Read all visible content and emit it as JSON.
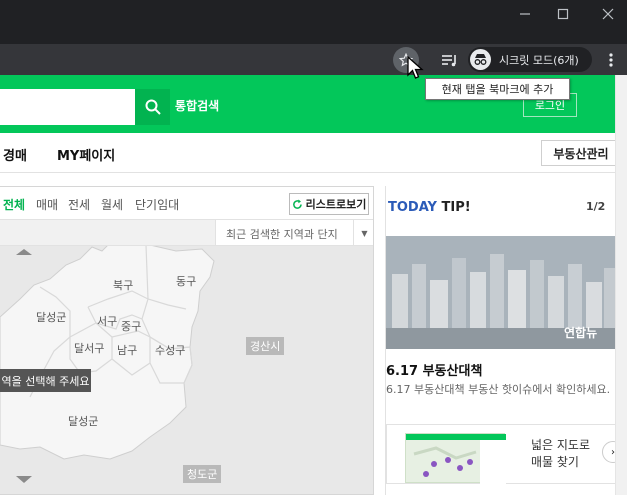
{
  "browser": {
    "incognito_label": "시크릿 모드(6개)",
    "tooltip": "현재 탭을 북마크에 추가",
    "icons": [
      "minimize-icon",
      "maximize-icon",
      "close-icon",
      "star-icon",
      "reading-list-icon",
      "incognito-icon",
      "kebab-menu-icon"
    ]
  },
  "header": {
    "search_value": "",
    "search_button_label": "통합검색",
    "login_label": "로그인",
    "accent": "#03c75a"
  },
  "nav": {
    "items": [
      "경매",
      "MY페이지"
    ],
    "realty_management": "부동산관리"
  },
  "map_panel": {
    "filters": [
      "전체",
      "매매",
      "전세",
      "월세",
      "단기임대"
    ],
    "active_filter": "전체",
    "list_view_button": "리스트로보기",
    "recent_search": "최근 검색한 지역과 단지",
    "select_tip": "역을 선택해 주세요",
    "districts": [
      "북구",
      "동구",
      "달성군",
      "서구",
      "중구",
      "달서구",
      "남구",
      "수성구",
      "경산시",
      "달성군",
      "청도군"
    ]
  },
  "today_tip": {
    "title_highlight": "TODAY",
    "title_rest": "TIP!",
    "pager": "1/2",
    "photo_credit": "연합뉴",
    "news_title": "6.17 부동산대책",
    "news_desc": "6.17 부동산대책 부동산 핫이슈에서 확인하세요.",
    "banner_line1": "넓은 지도로",
    "banner_line2": "매물 찾기"
  }
}
